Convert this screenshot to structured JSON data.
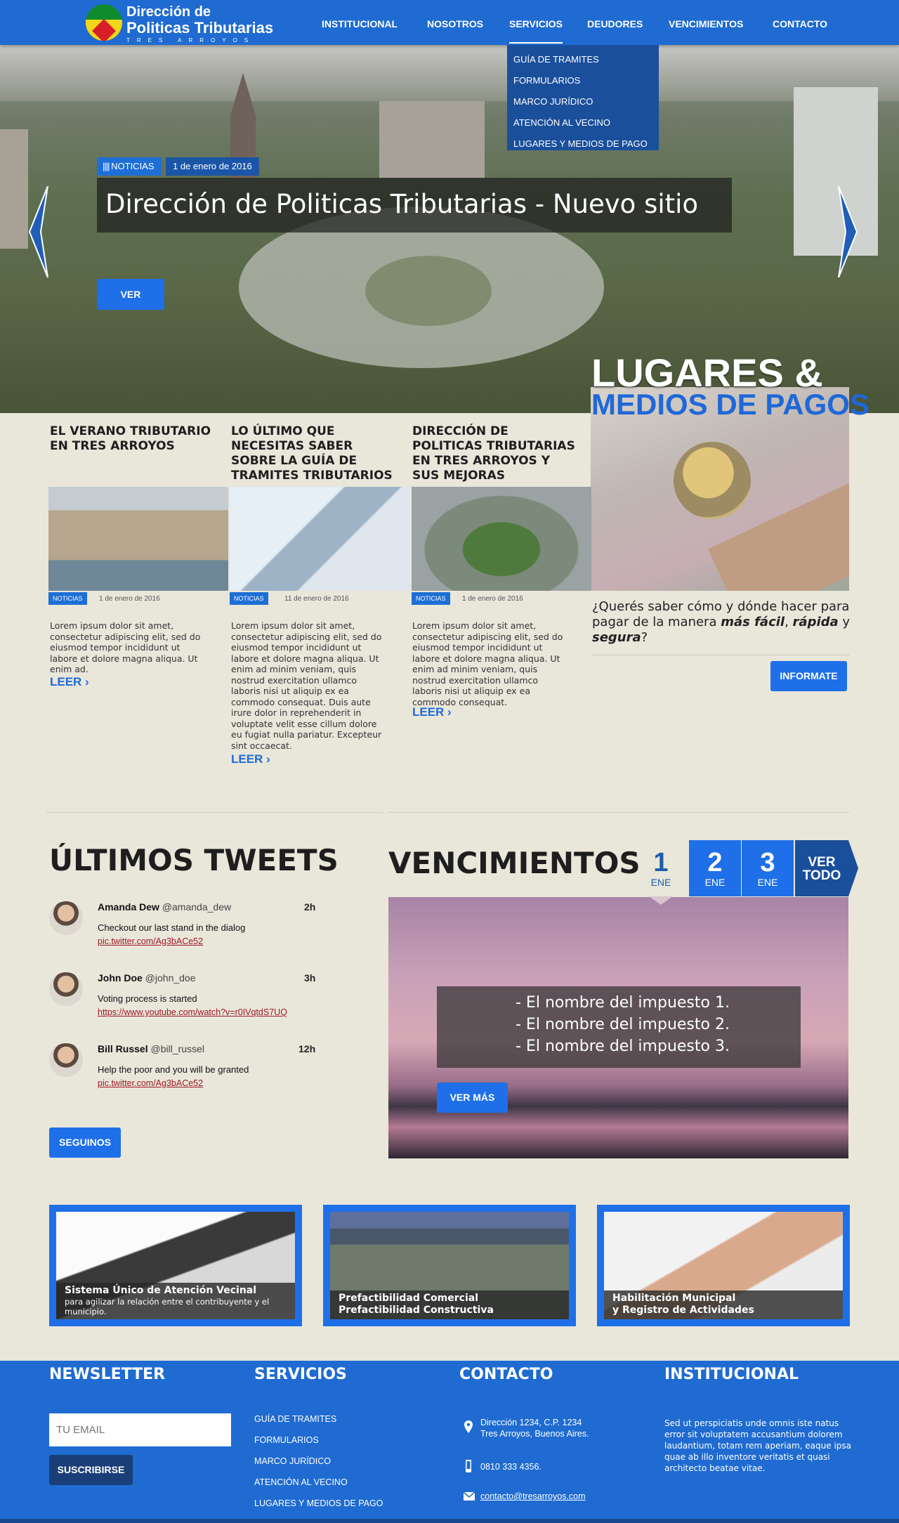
{
  "logo": {
    "line1": "Dirección de",
    "line2": "Politicas Tributarias",
    "line3": "TRES ARROYOS"
  },
  "nav": {
    "items": [
      "INSTITUCIONAL",
      "NOSOTROS",
      "SERVICIOS",
      "DEUDORES",
      "VENCIMIENTOS",
      "CONTACTO"
    ],
    "active": "SERVICIOS",
    "dropdown": [
      "GUÍA DE TRAMITES",
      "FORMULARIOS",
      "MARCO JURÍDICO",
      "ATENCIÓN AL VECINO",
      "LUGARES Y MEDIOS DE PAGO"
    ]
  },
  "hero": {
    "tag": "NOTICIAS",
    "date": "1 de enero de 2016",
    "title": "Dirección de Politicas Tributarias - Nuevo sitio",
    "button": "VER"
  },
  "lugares": {
    "title1": "LUGARES &",
    "title2": "MEDIOS DE PAGOS",
    "text_a": "¿Querés saber cómo y dónde hacer para pagar de la manera ",
    "text_b": "más fácil",
    "text_c": ", ",
    "text_d": "rápida",
    "text_e": " y ",
    "text_f": "segura",
    "text_g": "?",
    "button": "INFORMATE"
  },
  "news": [
    {
      "title": "EL VERANO TRIBUTARIO EN TRES ARROYOS",
      "tag": "NOTICIAS",
      "date": "1 de enero de 2016",
      "text": "Lorem ipsum dolor sit amet, consectetur adipiscing elit, sed do eiusmod tempor incididunt ut labore et dolore magna aliqua. Ut enim ad.",
      "more": "LEER ›"
    },
    {
      "title": "LO ÚLTIMO QUE NECESITAS SABER SOBRE LA GUÍA DE TRAMITES TRIBUTARIOS",
      "tag": "NOTICIAS",
      "date": "11 de enero de 2016",
      "text": "Lorem ipsum dolor sit amet, consectetur adipiscing elit, sed do eiusmod tempor incididunt ut labore et dolore magna aliqua. Ut enim ad minim veniam, quis nostrud exercitation ullamco laboris nisi ut aliquip ex ea commodo consequat. Duis aute irure dolor in reprehenderit in voluptate velit esse cillum dolore eu fugiat nulla pariatur. Excepteur sint occaecat.",
      "more": "LEER ›"
    },
    {
      "title": "DIRECCIÓN DE POLITICAS TRIBUTARIAS EN TRES ARROYOS Y SUS MEJORAS",
      "tag": "NOTICIAS",
      "date": "1 de enero de 2016",
      "text": "Lorem ipsum dolor sit amet, consectetur adipiscing elit, sed do eiusmod tempor incididunt ut labore et dolore magna aliqua. Ut enim ad minim veniam, quis nostrud exercitation ullamco laboris nisi ut aliquip ex ea commodo consequat.",
      "more": "LEER ›"
    }
  ],
  "tweets": {
    "title": "ÚLTIMOS TWEETS",
    "items": [
      {
        "name": "Amanda Dew",
        "handle": "@amanda_dew",
        "time": "2h",
        "text": "Checkout our last stand in the dialog",
        "link": "pic.twitter.com/Ag3bACe52"
      },
      {
        "name": "John Doe",
        "handle": "@john_doe",
        "time": "3h",
        "text": "Voting process is started",
        "link": "https://www.youtube.com/watch?v=r0IVqtdS7UQ"
      },
      {
        "name": "Bill Russel",
        "handle": "@bill_russel",
        "time": "12h",
        "text": "Help the poor and you will be granted",
        "link": "pic.twitter.com/Ag3bACe52"
      }
    ],
    "button": "SEGUINOS"
  },
  "vencimientos": {
    "title": "VENCIMIENTOS",
    "tabs": [
      {
        "num": "1",
        "month": "ENE"
      },
      {
        "num": "2",
        "month": "ENE"
      },
      {
        "num": "3",
        "month": "ENE"
      }
    ],
    "all_line1": "VER",
    "all_line2": "TODO",
    "items": [
      "- El nombre del impuesto 1.",
      "- El nombre del impuesto 2.",
      "- El nombre del impuesto 3."
    ],
    "button": "VER MÁS"
  },
  "cards": [
    {
      "line1": "Sistema Único de Atención Vecinal",
      "line2": "para agilizar la relación entre el contribuyente y el municipio."
    },
    {
      "line1": "Prefactibilidad Comercial",
      "line2": "Prefactibilidad Constructiva"
    },
    {
      "line1": "Habilitación Municipal",
      "line2": "y Registro de Actividades"
    }
  ],
  "footer": {
    "newsletter": {
      "title": "NEWSLETTER",
      "placeholder": "TU EMAIL",
      "button": "SUSCRIBIRSE"
    },
    "servicios": {
      "title": "SERVICIOS",
      "items": [
        "GUÍA DE TRAMITES",
        "FORMULARIOS",
        "MARCO JURÍDICO",
        "ATENCIÓN AL VECINO",
        "LUGARES Y MEDIOS DE PAGO"
      ]
    },
    "contacto": {
      "title": "CONTACTO",
      "address1": "Dirección 1234, C.P. 1234",
      "address2": "Tres Arroyos, Buenos Aires.",
      "phone": "0810 333 4356.",
      "email": "contacto@tresarroyos.com"
    },
    "institucional": {
      "title": "INSTITUCIONAL",
      "text": "Sed ut perspiciatis unde omnis iste natus error sit voluptatem accusantium dolorem laudantium, totam rem aperiam, eaque ipsa quae ab illo inventore veritatis et quasi architecto beatae vitae."
    }
  },
  "colors": {
    "primary": "#1f6bd1",
    "button": "#1f70e8",
    "dark": "#1a4f9c",
    "background": "#e9e6da"
  }
}
